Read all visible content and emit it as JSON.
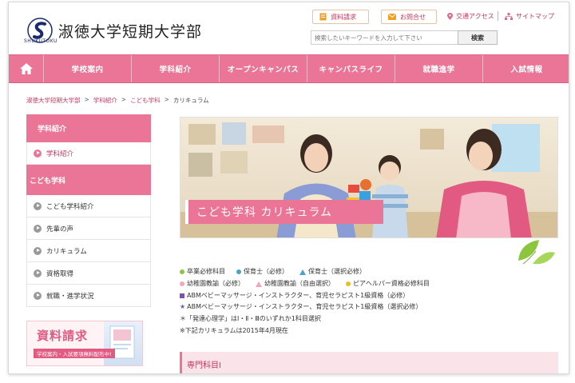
{
  "header": {
    "logo_title": "淑徳大学短期大学部",
    "logo_sub": "SHUKUTOKU",
    "buttons": {
      "brochure": "資料請求",
      "contact": "お問合せ"
    },
    "links": {
      "access": "交通アクセス",
      "sitemap": "サイトマップ"
    },
    "search": {
      "placeholder": "検索したいキーワードを入力して下さい",
      "button": "検索"
    }
  },
  "nav": {
    "items": [
      "学校案内",
      "学科紹介",
      "オープンキャンパス",
      "キャンパスライフ",
      "就職進学",
      "入試情報"
    ]
  },
  "breadcrumb": {
    "items": [
      "淑徳大学短期大学部",
      "学科紹介",
      "こども学科",
      "カリキュラム"
    ]
  },
  "sidebar": {
    "header": "学科紹介",
    "items": [
      "学科紹介"
    ],
    "sub_header": "こども学科",
    "sub_items": [
      "こども学科紹介",
      "先輩の声",
      "カリキュラム",
      "資格取得",
      "就職・進学状況"
    ]
  },
  "banner": {
    "title": "資料請求",
    "subtitle": "学校案内・入試要項無料配布中!"
  },
  "hero": {
    "title": "こども学科 カリキュラム"
  },
  "legend": {
    "required": "卒業必修科目",
    "nursery_req": "保育士（必修）",
    "nursery_elec": "保育士（選択必修）",
    "kinder_req": "幼稚園教諭（必修）",
    "kinder_elec": "幼稚園教諭（自由選択）",
    "peer_helper": "ピアヘルパー資格必修科目",
    "abm_req": "ABMベビーマッサージ・インストラクター、育児セラピスト1級資格（必修）",
    "abm_elec": "ABMベビーマッサージ・インストラクター、育児セラピスト1級資格（選択必修）",
    "note1": "＊「発達心理学」はⅠ・Ⅱ・Ⅲのいずれか1科目選択",
    "note2": "※下記カリキュラムは2015年4月現在"
  },
  "section": {
    "title": "専門科目Ⅰ"
  },
  "colors": {
    "accent": "#ea7596",
    "link": "#c2385e",
    "green": "#8cc63f",
    "blue": "#4aa2c7",
    "pink_light": "#f4a6b8",
    "yellow": "#e8c21a",
    "purple": "#7b4fb4"
  }
}
